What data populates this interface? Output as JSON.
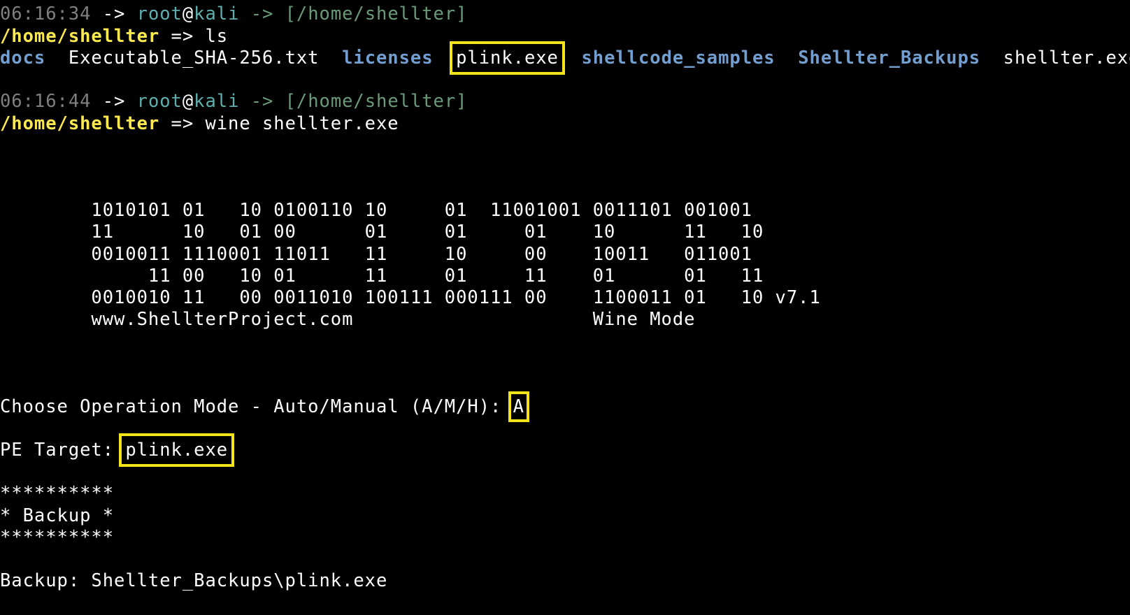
{
  "prompt1": {
    "time": "06:16:34",
    "arrow1": " -> ",
    "user": "root",
    "at": "@",
    "host": "kali",
    "arrow2": " -> ",
    "path": "[/home/shellter]"
  },
  "cmd1": {
    "cwd": "/home/shellter",
    "sep": " => ",
    "command": "ls"
  },
  "ls": {
    "entries": [
      {
        "name": "docs",
        "kind": "dir"
      },
      {
        "name": "Executable_SHA-256.txt",
        "kind": "file"
      },
      {
        "name": "licenses",
        "kind": "dir"
      },
      {
        "name": "plink.exe",
        "kind": "file"
      },
      {
        "name": "shellcode_samples",
        "kind": "dir"
      },
      {
        "name": "Shellter_Backups",
        "kind": "dir"
      },
      {
        "name": "shellter.exe",
        "kind": "file"
      }
    ]
  },
  "prompt2": {
    "time": "06:16:44",
    "arrow1": " -> ",
    "user": "root",
    "at": "@",
    "host": "kali",
    "arrow2": " -> ",
    "path": "[/home/shellter]"
  },
  "cmd2": {
    "cwd": "/home/shellter",
    "sep": " => ",
    "command": "wine shellter.exe"
  },
  "banner": {
    "lines": [
      "        1010101 01   10 0100110 10     01  11001001 0011101 001001",
      "        11      10   01 00      01     01     01    10      11   10",
      "        0010011 1110001 11011   11     10     00    10011   011001",
      "             11 00   10 01      11     01     11    01      01   11",
      "        0010010 11   00 0011010 100111 000111 00    1100011 01   10 v7.1",
      "        www.ShellterProject.com                     Wine Mode"
    ]
  },
  "mode": {
    "prompt": "Choose Operation Mode - Auto/Manual (A/M/H): ",
    "answer": "A"
  },
  "target": {
    "prompt": "PE Target: ",
    "answer": "plink.exe"
  },
  "backup_section": {
    "border_top": "**********",
    "title": "* Backup *",
    "border_bottom": "**********",
    "label": "Backup: ",
    "value": "Shellter_Backups\\plink.exe"
  }
}
